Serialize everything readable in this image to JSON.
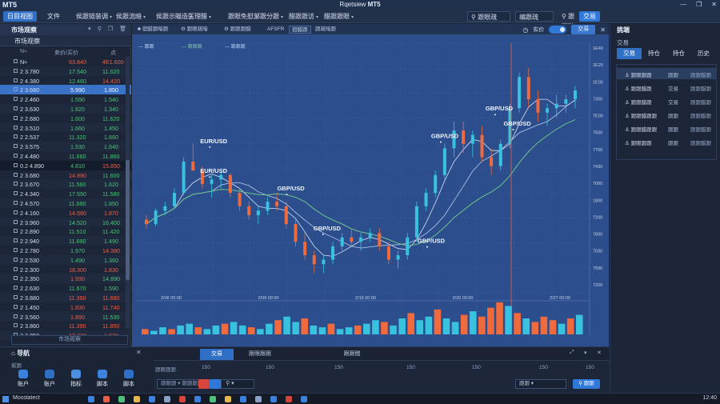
{
  "window": {
    "app_name": "MT5",
    "title_prefix": "Rqetsiew",
    "title_bold": "MT5",
    "controls": [
      "—",
      "❐",
      "✕"
    ]
  },
  "menubar": {
    "items": [
      {
        "label": "日目视图",
        "active": true
      },
      {
        "label": "文件",
        "active": false
      },
      {
        "label": "侯跟链装调",
        "arrow": true
      },
      {
        "label": "侯跟流暗",
        "arrow": true
      },
      {
        "label": "侯跟示瞄造",
        "arrow": true
      },
      {
        "label": "医理醋",
        "arrow": true
      },
      {
        "label": "跟眼免慰",
        "arrow": true
      },
      {
        "label": "部跟分跟",
        "arrow": true
      },
      {
        "label": "醋跟跟访",
        "arrow": true
      },
      {
        "label": "醋跟跟眼",
        "arrow": true
      }
    ],
    "account_select": "⚲ 跟眼疏",
    "server_select": "编跟疏",
    "login_label": "⚲ 跟眼疏",
    "login_button": "交易"
  },
  "market_watch": {
    "title": "市场观察",
    "subtitle": "市场观察",
    "columns": {
      "symbol": "N≈",
      "bid": "卖价/买价",
      "ask": "点"
    },
    "rows": [
      {
        "sym": "N≈",
        "bid": "63.840",
        "ask": "4E1.600",
        "bidc": "red",
        "askc": "red"
      },
      {
        "sym": "2 3.780",
        "bid": "17.540",
        "ask": "11.620",
        "bidc": "green",
        "askc": "green"
      },
      {
        "sym": "2 4.380",
        "bid": "12.460",
        "ask": "14.420",
        "bidc": "green",
        "askc": "red"
      },
      {
        "sym": "2 3.680",
        "bid": "5.990",
        "ask": "1.850",
        "bidc": "white",
        "askc": "white",
        "sel": true
      },
      {
        "sym": "2 2.460",
        "bid": "1.590",
        "ask": "1.540",
        "bidc": "green",
        "askc": "green"
      },
      {
        "sym": "2 3.630",
        "bid": "1.820",
        "ask": "1.340",
        "bidc": "green",
        "askc": "green"
      },
      {
        "sym": "2 2.680",
        "bid": "1.600",
        "ask": "11.620",
        "bidc": "green",
        "askc": "green"
      },
      {
        "sym": "2 3.510",
        "bid": "1.660",
        "ask": "1.450",
        "bidc": "green",
        "askc": "green"
      },
      {
        "sym": "2 2.537",
        "bid": "11.320",
        "ask": "1.660",
        "bidc": "green",
        "askc": "green"
      },
      {
        "sym": "2 3.575",
        "bid": "1.530",
        "ask": "1.640",
        "bidc": "green",
        "askc": "green"
      },
      {
        "sym": "2 4.480",
        "bid": "11.660",
        "ask": "11.860",
        "bidc": "green",
        "askc": "green"
      },
      {
        "sym": "0.2 4.890",
        "bid": "4.810",
        "ask": "15.850",
        "bidc": "green",
        "askc": "red",
        "dark": true
      },
      {
        "sym": "2 3.680",
        "bid": "14.890",
        "ask": "11.600",
        "bidc": "red",
        "askc": "green"
      },
      {
        "sym": "2 3.670",
        "bid": "11.560",
        "ask": "1.620",
        "bidc": "green",
        "askc": "green"
      },
      {
        "sym": "2 4.340",
        "bid": "17.550",
        "ask": "11.580",
        "bidc": "green",
        "askc": "green"
      },
      {
        "sym": "2 4.570",
        "bid": "11.680",
        "ask": "1.850",
        "bidc": "green",
        "askc": "green"
      },
      {
        "sym": "2 4.160",
        "bid": "14.580",
        "ask": "1.870",
        "bidc": "red",
        "askc": "red"
      },
      {
        "sym": "2 3.960",
        "bid": "14.520",
        "ask": "16.400",
        "bidc": "green",
        "askc": "green"
      },
      {
        "sym": "2 2.890",
        "bid": "11.510",
        "ask": "11.420",
        "bidc": "green",
        "askc": "green"
      },
      {
        "sym": "2 2.940",
        "bid": "11.690",
        "ask": "1.490",
        "bidc": "green",
        "askc": "green"
      },
      {
        "sym": "2 2.780",
        "bid": "1.970",
        "ask": "14.380",
        "bidc": "green",
        "askc": "red"
      },
      {
        "sym": "2 2.530",
        "bid": "1.490",
        "ask": "1.360",
        "bidc": "green",
        "askc": "green"
      },
      {
        "sym": "2 2.300",
        "bid": "18.300",
        "ask": "1.830",
        "bidc": "red",
        "askc": "red"
      },
      {
        "sym": "2 2.350",
        "bid": "1.930",
        "ask": "14.890",
        "bidc": "red",
        "askc": "green"
      },
      {
        "sym": "2 2.630",
        "bid": "11.670",
        "ask": "1.590",
        "bidc": "green",
        "askc": "green"
      },
      {
        "sym": "2 3.880",
        "bid": "11.390",
        "ask": "11.690",
        "bidc": "red",
        "askc": "red"
      },
      {
        "sym": "2 1.450",
        "bid": "1.830",
        "ask": "11.740",
        "bidc": "red",
        "askc": "red"
      },
      {
        "sym": "2 3.560",
        "bid": "1.890",
        "ask": "11.530",
        "bidc": "red",
        "askc": "green"
      },
      {
        "sym": "2 3.860",
        "bid": "11.390",
        "ask": "11.850",
        "bidc": "red",
        "askc": "red"
      },
      {
        "sym": "2 2.850",
        "bid": "17.330",
        "ask": "1.630",
        "bidc": "red",
        "askc": "red"
      }
    ],
    "footer": "市场观察"
  },
  "chart": {
    "toolbar_items": [
      "■ 宿醋跟暗跟",
      "⚙ 跟眼疏暗",
      "⚙ 跟跟跟醋",
      "AFSFR",
      "宿醋跟",
      "跟疏暗跟"
    ],
    "legend": [
      "— 跟跟",
      "— 跟眼跟",
      "— 跟跟跟"
    ],
    "toggle_label": "实价",
    "trade_button": "交易",
    "labels": [
      {
        "text": "EUR/USD",
        "x": 14,
        "y": 40
      },
      {
        "text": "EUR/USD",
        "x": 14,
        "y": 52
      },
      {
        "text": "GBP/USD",
        "x": 31,
        "y": 59
      },
      {
        "text": "GBP/USD",
        "x": 65,
        "y": 38
      },
      {
        "text": "GBP/USD",
        "x": 77,
        "y": 27
      },
      {
        "text": "GBP/USD",
        "x": 62,
        "y": 80
      },
      {
        "text": "GBP/USD",
        "x": 81,
        "y": 33
      },
      {
        "text": "GBP/USD",
        "x": 39,
        "y": 75
      }
    ],
    "right_axis": [
      "1E40",
      "1E20",
      "1E00",
      "7300",
      "7E00",
      "7500",
      "7700",
      "7430",
      "7000",
      "1800",
      "7200",
      "7800",
      "7030",
      "7590",
      "7200"
    ],
    "x_axis": [
      "2/06 00:00",
      "2/09 00:00",
      "2/16 00:00",
      "2/20 00:00",
      "2/27 00:00"
    ]
  },
  "chart_data": {
    "type": "candlestick",
    "title": "",
    "series": [
      {
        "name": "OHLC",
        "values": [
          [
            90,
            92,
            86,
            88
          ],
          [
            88,
            95,
            87,
            94
          ],
          [
            94,
            98,
            92,
            96
          ],
          [
            96,
            104,
            95,
            102
          ],
          [
            102,
            118,
            101,
            116
          ],
          [
            116,
            124,
            114,
            112
          ],
          [
            112,
            114,
            104,
            106
          ],
          [
            106,
            110,
            100,
            108
          ],
          [
            108,
            112,
            104,
            110
          ],
          [
            110,
            111,
            100,
            102
          ],
          [
            102,
            104,
            94,
            96
          ],
          [
            96,
            98,
            90,
            92
          ],
          [
            92,
            96,
            88,
            94
          ],
          [
            94,
            100,
            92,
            98
          ],
          [
            98,
            102,
            94,
            96
          ],
          [
            96,
            98,
            86,
            88
          ],
          [
            88,
            90,
            78,
            80
          ],
          [
            80,
            84,
            72,
            74
          ],
          [
            74,
            76,
            66,
            70
          ],
          [
            70,
            74,
            66,
            72
          ],
          [
            72,
            80,
            70,
            78
          ],
          [
            78,
            84,
            76,
            82
          ],
          [
            82,
            86,
            78,
            80
          ],
          [
            80,
            84,
            76,
            82
          ],
          [
            82,
            86,
            80,
            84
          ],
          [
            84,
            86,
            76,
            78
          ],
          [
            78,
            80,
            70,
            72
          ],
          [
            72,
            76,
            68,
            74
          ],
          [
            74,
            84,
            72,
            82
          ],
          [
            82,
            98,
            80,
            96
          ],
          [
            96,
            104,
            94,
            102
          ],
          [
            102,
            112,
            100,
            110
          ],
          [
            110,
            124,
            108,
            122
          ],
          [
            122,
            134,
            118,
            130
          ],
          [
            130,
            134,
            120,
            124
          ],
          [
            124,
            130,
            118,
            128
          ],
          [
            128,
            132,
            116,
            118
          ],
          [
            118,
            122,
            110,
            114
          ],
          [
            114,
            126,
            112,
            124
          ],
          [
            124,
            142,
            122,
            140
          ],
          [
            140,
            156,
            138,
            154
          ],
          [
            154,
            158,
            140,
            144
          ],
          [
            144,
            148,
            134,
            138
          ],
          [
            138,
            142,
            132,
            140
          ],
          [
            140,
            146,
            136,
            142
          ],
          [
            142,
            146,
            138,
            144
          ],
          [
            144,
            150,
            140,
            148
          ]
        ]
      }
    ],
    "volumes": [
      3,
      2,
      4,
      3,
      5,
      6,
      4,
      3,
      5,
      6,
      7,
      5,
      4,
      3,
      6,
      8,
      10,
      7,
      9,
      5,
      4,
      6,
      3,
      4,
      5,
      6,
      8,
      7,
      5,
      9,
      12,
      8,
      10,
      14,
      9,
      7,
      11,
      13,
      10,
      15,
      18,
      16,
      12,
      9,
      7,
      10,
      8,
      6,
      9,
      11
    ],
    "xlabel": "",
    "ylabel": ""
  },
  "navigator": {
    "title": "导航",
    "subtitle": "揃跟",
    "items": [
      {
        "label": "账户",
        "color": "#3b82e0"
      },
      {
        "label": "账户",
        "color": "#2f6fc6"
      },
      {
        "label": "指标",
        "color": "#4a90e2"
      },
      {
        "label": "脚本",
        "color": "#3b82e0"
      },
      {
        "label": "脚本",
        "color": "#2f6fc6"
      }
    ]
  },
  "toolbox": {
    "tabs": [
      {
        "label": "交易",
        "active": true
      },
      {
        "label": "跟眼跟跟",
        "active": false
      },
      {
        "label": "跟跟醋",
        "active": false
      }
    ],
    "columns": [
      "跟眼跟跟",
      "150",
      "150",
      "150",
      "150",
      "150",
      "150",
      "150"
    ],
    "filter_placeholder": "跟眼跟 ▾ 跟跟跟跟",
    "search_label": "⚲ ▾",
    "right_select": "跟跟 ▾",
    "right_button": "⚲ 跟跟"
  },
  "trade_panel": {
    "title": "挑端",
    "subtitle": "交易",
    "tabs": [
      {
        "label": "交易",
        "active": true
      },
      {
        "label": "持仓",
        "active": false
      },
      {
        "label": "持仓",
        "active": false
      },
      {
        "label": "历史",
        "active": false
      }
    ],
    "rows": [
      {
        "a": "⚓ 跟眼跟跟",
        "b": "跟跟",
        "c": "跟跟醋跟",
        "sel": true
      },
      {
        "a": "⚓ 跟跟醋跟",
        "b": "交易",
        "c": "跟跟醋跟"
      },
      {
        "a": "⚓ 跟跟醋跟",
        "b": "交易",
        "c": "跟跟醋跟"
      },
      {
        "a": "⚓ 跟跟醋跟跟",
        "b": "跟跟",
        "c": "跟跟醋跟"
      },
      {
        "a": "⚓ 跟跟醋跟跟",
        "b": "跟跟",
        "c": "跟跟醋跟"
      },
      {
        "a": "⚓ 跟眼跟跟",
        "b": "跟跟",
        "c": "跟跟醋跟"
      }
    ]
  },
  "taskbar": {
    "app": "Mosstatect",
    "clock": "12:40"
  }
}
